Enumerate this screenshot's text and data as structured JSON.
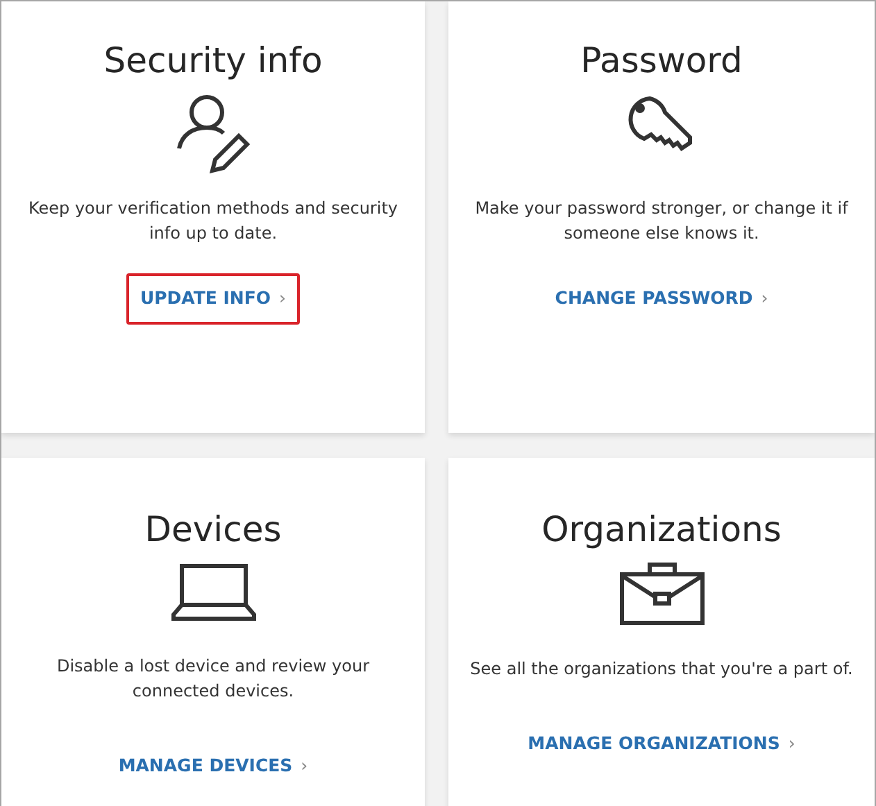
{
  "cards": [
    {
      "title": "Security info",
      "description": "Keep your verification methods and security info up to date.",
      "link": {
        "label": "UPDATE INFO",
        "arrow": "›",
        "highlighted": true
      }
    },
    {
      "title": "Password",
      "description": "Make your password stronger, or change it if someone else knows it.",
      "link": {
        "label": "CHANGE PASSWORD",
        "arrow": "›",
        "highlighted": false
      }
    },
    {
      "title": "Devices",
      "description": "Disable a lost device and review your connected devices.",
      "link": {
        "label": "MANAGE DEVICES",
        "arrow": "›",
        "highlighted": false
      }
    },
    {
      "title": "Organizations",
      "description": "See all the organizations that you're a part of.",
      "link": {
        "label": "MANAGE ORGANIZATIONS",
        "arrow": "›",
        "highlighted": false
      }
    }
  ]
}
